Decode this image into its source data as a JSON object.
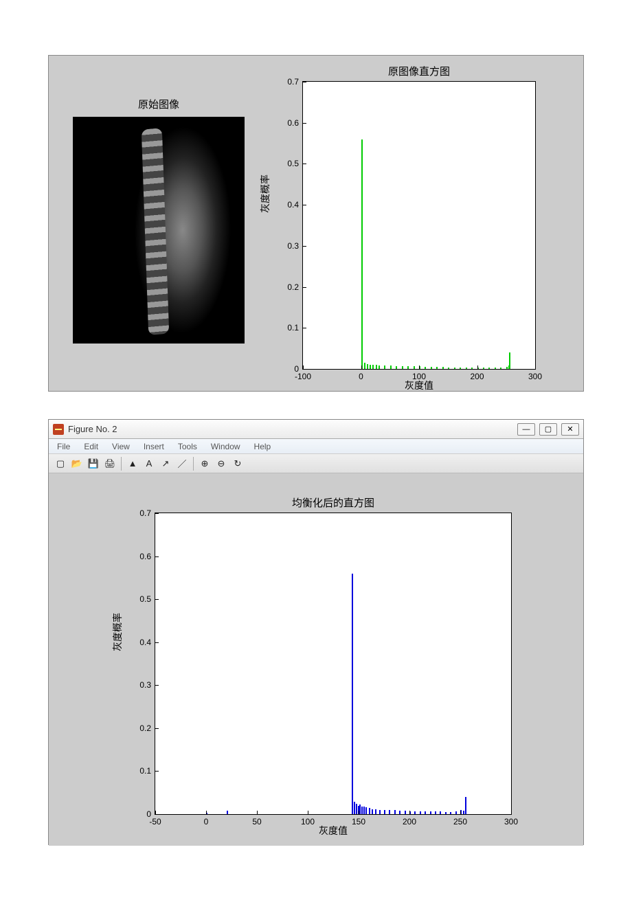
{
  "figure1": {
    "left_title": "原始图像",
    "right_title": "原图像直方图",
    "ylabel": "灰度概率",
    "xlabel": "灰度值"
  },
  "figure2": {
    "window_title": "Figure No. 2",
    "menu": {
      "file": "File",
      "edit": "Edit",
      "view": "View",
      "insert": "Insert",
      "tools": "Tools",
      "window": "Window",
      "help": "Help"
    },
    "chart_title": "均衡化后的直方图",
    "ylabel": "灰度概率",
    "xlabel": "灰度值"
  },
  "yticks": [
    "0.7",
    "0.6",
    "0.5",
    "0.4",
    "0.3",
    "0.2",
    "0.1",
    "0"
  ],
  "xticks1": [
    "-100",
    "0",
    "100",
    "200",
    "300"
  ],
  "xticks2": [
    "-50",
    "0",
    "50",
    "100",
    "150",
    "200",
    "250",
    "300"
  ],
  "chart_data": [
    {
      "type": "bar",
      "title": "原图像直方图",
      "xlabel": "灰度值",
      "ylabel": "灰度概率",
      "ylim": [
        0,
        0.7
      ],
      "xlim": [
        -100,
        300
      ],
      "color": "#00cc00",
      "x": [
        0,
        5,
        10,
        15,
        20,
        25,
        30,
        40,
        50,
        60,
        70,
        80,
        90,
        100,
        110,
        120,
        130,
        140,
        150,
        160,
        170,
        180,
        190,
        200,
        210,
        220,
        230,
        240,
        250,
        254,
        255
      ],
      "values": [
        0.56,
        0.015,
        0.012,
        0.01,
        0.01,
        0.01,
        0.008,
        0.008,
        0.008,
        0.007,
        0.007,
        0.006,
        0.006,
        0.006,
        0.005,
        0.005,
        0.005,
        0.005,
        0.004,
        0.004,
        0.004,
        0.004,
        0.003,
        0.003,
        0.003,
        0.003,
        0.003,
        0.003,
        0.005,
        0.008,
        0.04
      ]
    },
    {
      "type": "bar",
      "title": "均衡化后的直方图",
      "xlabel": "灰度值",
      "ylabel": "灰度概率",
      "ylim": [
        0,
        0.7
      ],
      "xlim": [
        -50,
        300
      ],
      "color": "#0000dd",
      "x": [
        0,
        20,
        143,
        145,
        147,
        149,
        151,
        153,
        155,
        157,
        160,
        163,
        166,
        170,
        175,
        180,
        185,
        190,
        195,
        200,
        205,
        210,
        215,
        220,
        225,
        230,
        235,
        240,
        245,
        250,
        253,
        255
      ],
      "values": [
        0.004,
        0.008,
        0.56,
        0.028,
        0.024,
        0.02,
        0.022,
        0.018,
        0.018,
        0.016,
        0.014,
        0.012,
        0.012,
        0.01,
        0.01,
        0.009,
        0.009,
        0.008,
        0.008,
        0.007,
        0.007,
        0.007,
        0.006,
        0.006,
        0.006,
        0.006,
        0.005,
        0.005,
        0.006,
        0.01,
        0.008,
        0.04
      ]
    }
  ]
}
